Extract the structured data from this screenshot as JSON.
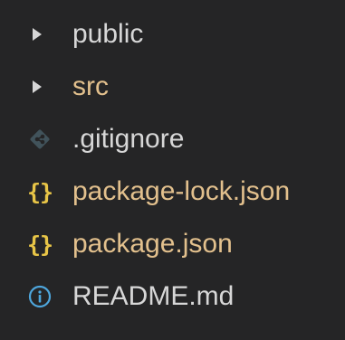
{
  "explorer": {
    "items": [
      {
        "label": "public",
        "kind": "folder",
        "icon": "chevron-right-icon",
        "color": "#d7d7d7"
      },
      {
        "label": "src",
        "kind": "folder",
        "icon": "chevron-right-icon",
        "color": "#e2c08d"
      },
      {
        "label": ".gitignore",
        "kind": "file",
        "icon": "git-icon",
        "color": "#d7d7d7"
      },
      {
        "label": "package-lock.json",
        "kind": "file",
        "icon": "json-braces-icon",
        "color": "#e2c08d"
      },
      {
        "label": "package.json",
        "kind": "file",
        "icon": "json-braces-icon",
        "color": "#e2c08d"
      },
      {
        "label": "README.md",
        "kind": "file",
        "icon": "info-icon",
        "color": "#d7d7d7"
      }
    ],
    "icon_glyphs": {
      "json": "{}"
    },
    "colors": {
      "background": "#252526",
      "json_icon": "#e8c547",
      "info_icon": "#4ea6dc",
      "git_icon": "#41535b"
    }
  }
}
